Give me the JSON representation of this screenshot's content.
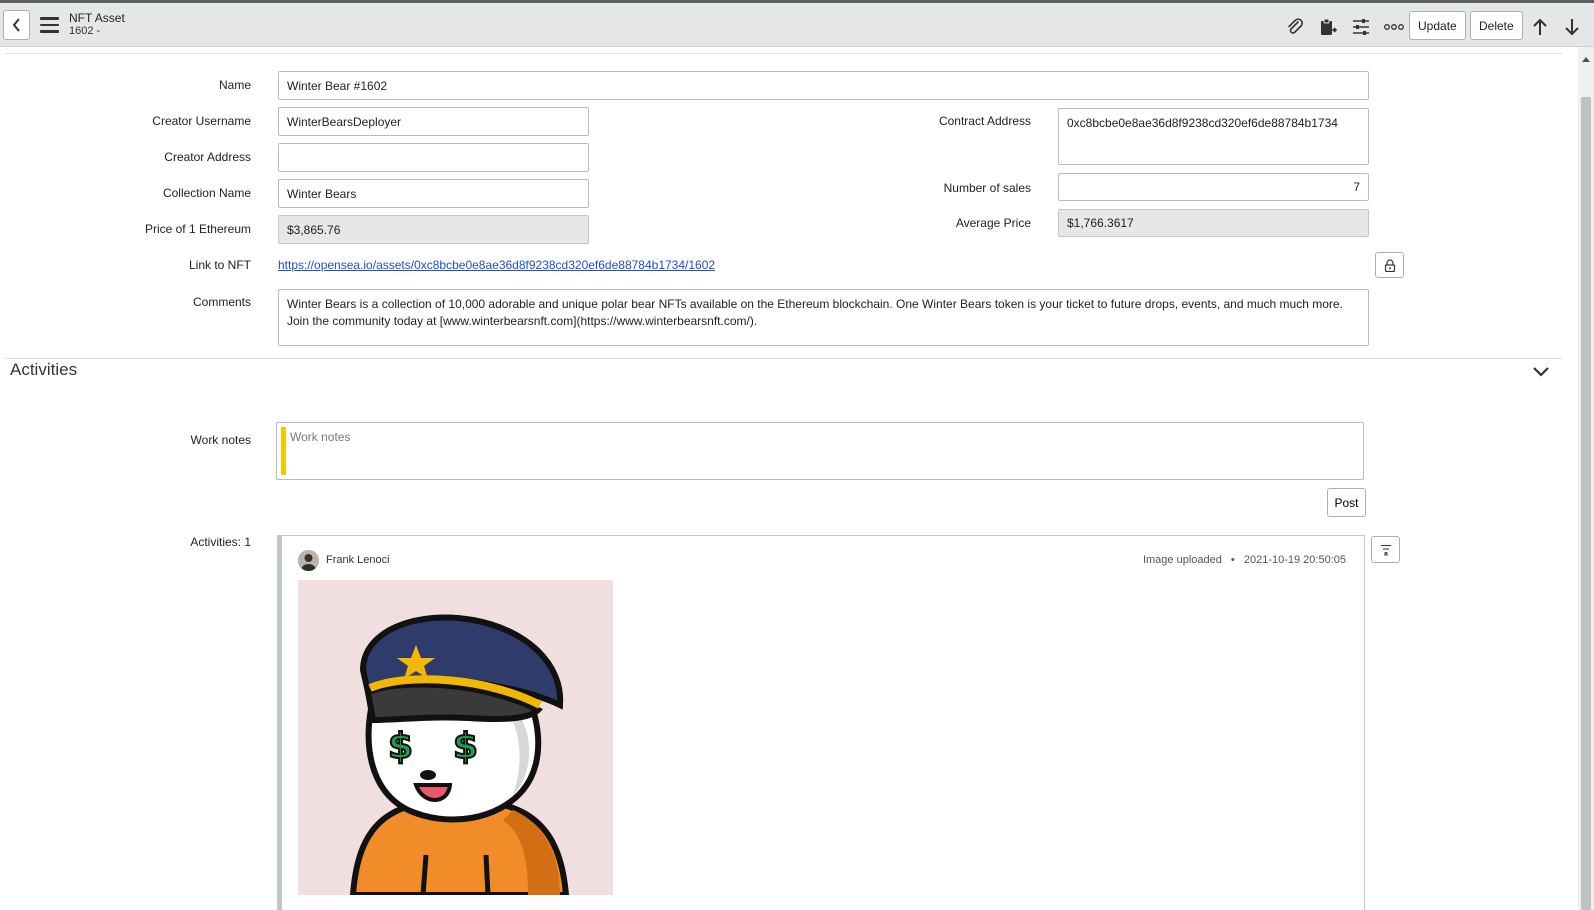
{
  "header": {
    "title": "NFT Asset",
    "subtitle": "1602 -",
    "update_label": "Update",
    "delete_label": "Delete"
  },
  "form": {
    "name": {
      "label": "Name",
      "value": "Winter Bear #1602"
    },
    "creator_username": {
      "label": "Creator Username",
      "value": "WinterBearsDeployer"
    },
    "creator_address": {
      "label": "Creator Address",
      "value": ""
    },
    "collection_name": {
      "label": "Collection Name",
      "value": "Winter Bears"
    },
    "price_eth": {
      "label": "Price of 1 Ethereum",
      "value": "$3,865.76"
    },
    "link": {
      "label": "Link to NFT",
      "value": "https://opensea.io/assets/0xc8bcbe0e8ae36d8f9238cd320ef6de88784b1734/1602"
    },
    "comments": {
      "label": "Comments",
      "value": "Winter Bears is a collection of 10,000 adorable and unique polar bear NFTs available on the Ethereum blockchain. One Winter Bears token is your ticket to future drops, events, and much much more. Join the community today at [www.winterbearsnft.com](https://www.winterbearsnft.com/)."
    },
    "contract_address": {
      "label": "Contract Address",
      "value": "0xc8bcbe0e8ae36d8f9238cd320ef6de88784b1734"
    },
    "number_of_sales": {
      "label": "Number of sales",
      "value": "7"
    },
    "average_price": {
      "label": "Average Price",
      "value": "$1,766.3617"
    }
  },
  "activities": {
    "title": "Activities",
    "work_notes_label": "Work notes",
    "work_notes_placeholder": "Work notes",
    "post_label": "Post",
    "count_label": "Activities: 1",
    "entry": {
      "user": "Frank Lenoci",
      "action": "Image uploaded",
      "timestamp": "2021-10-19 20:50:05"
    }
  },
  "colors": {
    "header_bg": "#e4e6e7",
    "link": "#1f4ed1",
    "worknote_accent": "#f5c800",
    "readonly_bg": "#e6e7e8"
  }
}
